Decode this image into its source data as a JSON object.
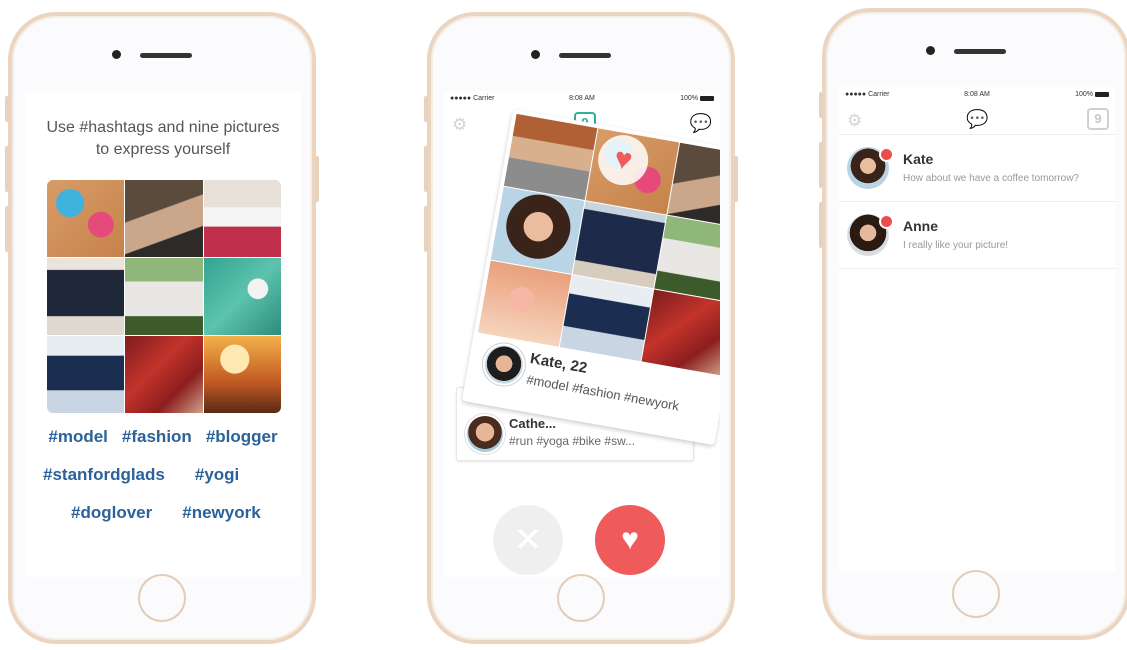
{
  "phone1": {
    "intro_line1": "Use #hashtags and nine pictures",
    "intro_line2": "to express yourself",
    "hashtags_row1": [
      "#model",
      "#fashion",
      "#blogger"
    ],
    "hashtags_row2": [
      "#stanfordglads",
      "#yogi"
    ],
    "hashtags_row3": [
      "#doglover",
      "#newyork"
    ]
  },
  "status_bar": {
    "carrier": "●●●●● Carrier",
    "time": "8:08 AM",
    "battery": "100%"
  },
  "phone2": {
    "header_badge": "9",
    "front_card": {
      "name": "Kate, 22",
      "tags": "#model #fashion #newyork"
    },
    "back_card": {
      "name": "Cathe...",
      "tags": "#run #yoga #bike #sw..."
    },
    "dislike_symbol": "✕",
    "like_symbol": "♥"
  },
  "phone3": {
    "header_badge": "9",
    "chats": [
      {
        "name": "Kate",
        "message": "How about we have a coffee tomorrow?"
      },
      {
        "name": "Anne",
        "message": "I really like your picture!"
      }
    ]
  },
  "icons": {
    "settings": "gear-icon",
    "chat": "chat-bubble-icon",
    "like": "heart-icon",
    "dislike": "close-icon"
  },
  "colors": {
    "hashtag_blue": "#2a6299",
    "accent_teal": "#2bb09b",
    "like_red": "#ef5a5a",
    "phone_frame": "#ecd5c0"
  }
}
